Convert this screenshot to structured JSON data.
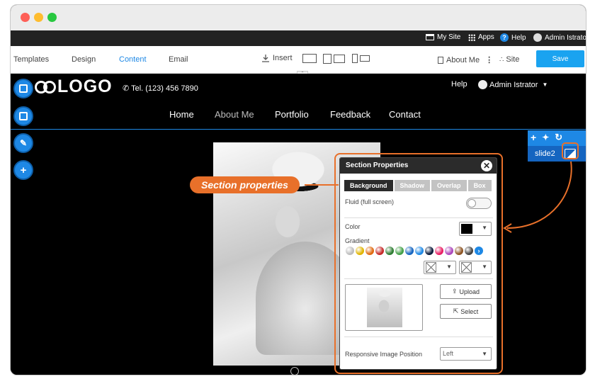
{
  "admin_bar": {
    "my_site": "My Site",
    "apps": "Apps",
    "help": "Help",
    "user": "Admin Istrator"
  },
  "toolbar": {
    "tabs": [
      "Templates",
      "Design",
      "Content",
      "Email"
    ],
    "active_tab": "Content",
    "insert": "Insert",
    "about_me": "About Me",
    "site": "Site",
    "save": "Save"
  },
  "site": {
    "logo": "LOGO",
    "tel": "Tel. (123) 456 7890",
    "help": "Help",
    "user": "Admin Istrator",
    "menu": [
      "Home",
      "About Me",
      "Portfolio",
      "Feedback",
      "Contact"
    ]
  },
  "slide_panel": {
    "label": "slide2"
  },
  "callout": "Section properties",
  "section_properties": {
    "title": "Section Properties",
    "tabs": [
      "Background",
      "Shadow",
      "Overlap",
      "Box"
    ],
    "fluid_label": "Fluid (full screen)",
    "color_label": "Color",
    "color_value": "#000000",
    "gradient_label": "Gradient",
    "gradient_swatches": [
      "#bdbdbd",
      "#e0b400",
      "#e06a10",
      "#c62828",
      "#2e7d32",
      "#43a047",
      "#1565c0",
      "#1e88e5",
      "#0b1a3a",
      "#e91e63",
      "#ab47bc",
      "#8d5524",
      "#424242"
    ],
    "upload": "Upload",
    "select": "Select",
    "responsive_label": "Responsive Image Position",
    "responsive_value": "Left"
  },
  "colors": {
    "accent": "#1e88e5",
    "highlight": "#e8702a",
    "save_button": "#1aa3f0"
  }
}
